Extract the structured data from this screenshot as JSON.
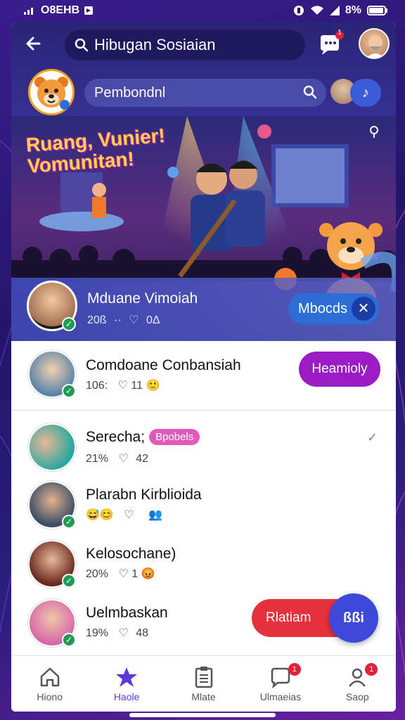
{
  "status_bar": {
    "left": "O8EHB",
    "battery": "8%"
  },
  "header": {
    "search_text": "Hibugan Sosiaian",
    "chat_badge": "1",
    "secondary_search": "Pembondnl"
  },
  "hero": {
    "title_line1": "Ruang, Vunier!",
    "title_line2": "Vomunitan!",
    "host_name": "Mduane Vimoiah",
    "host_count": "20ß",
    "host_sep": "··",
    "host_likes": "0Δ",
    "moods_label": "Mbocds",
    "close_label": "✕"
  },
  "list": [
    {
      "name": "Comdoane Conbansiah",
      "count": "106:",
      "likes": "11",
      "emoji": "🙂",
      "verified": true,
      "action": "Heamioly"
    },
    {
      "name": "Serecha;",
      "badge": "Bpobels",
      "count": "21%",
      "likes": "42",
      "verified": false
    },
    {
      "name": "Plarabn Kirblioida",
      "count": "😅😊",
      "likes": "",
      "emoji": "👥",
      "verified": true
    },
    {
      "name": "Kelosochane)",
      "count": "20%",
      "likes": "1",
      "emoji": "😡",
      "verified": true
    },
    {
      "name": "Uelmbaskan",
      "count": "19%",
      "likes": "48",
      "verified": true
    }
  ],
  "live_action": "Rlatiam",
  "fab_label": "ßßi",
  "nav": [
    {
      "label": "Hiono",
      "icon": "home-icon",
      "badge": ""
    },
    {
      "label": "Haole",
      "icon": "star-icon",
      "badge": ""
    },
    {
      "label": "Mlate",
      "icon": "clipboard-icon",
      "badge": ""
    },
    {
      "label": "Ulmaeias",
      "icon": "chat-bubble-icon",
      "badge": "1"
    },
    {
      "label": "Saop",
      "icon": "profile-icon",
      "badge": "1"
    }
  ],
  "colors": {
    "accent": "#5a3bd8",
    "follow": "#9b1cc4",
    "live": "#e5313c",
    "fab": "#3c49d9",
    "header": "#2a2577"
  }
}
